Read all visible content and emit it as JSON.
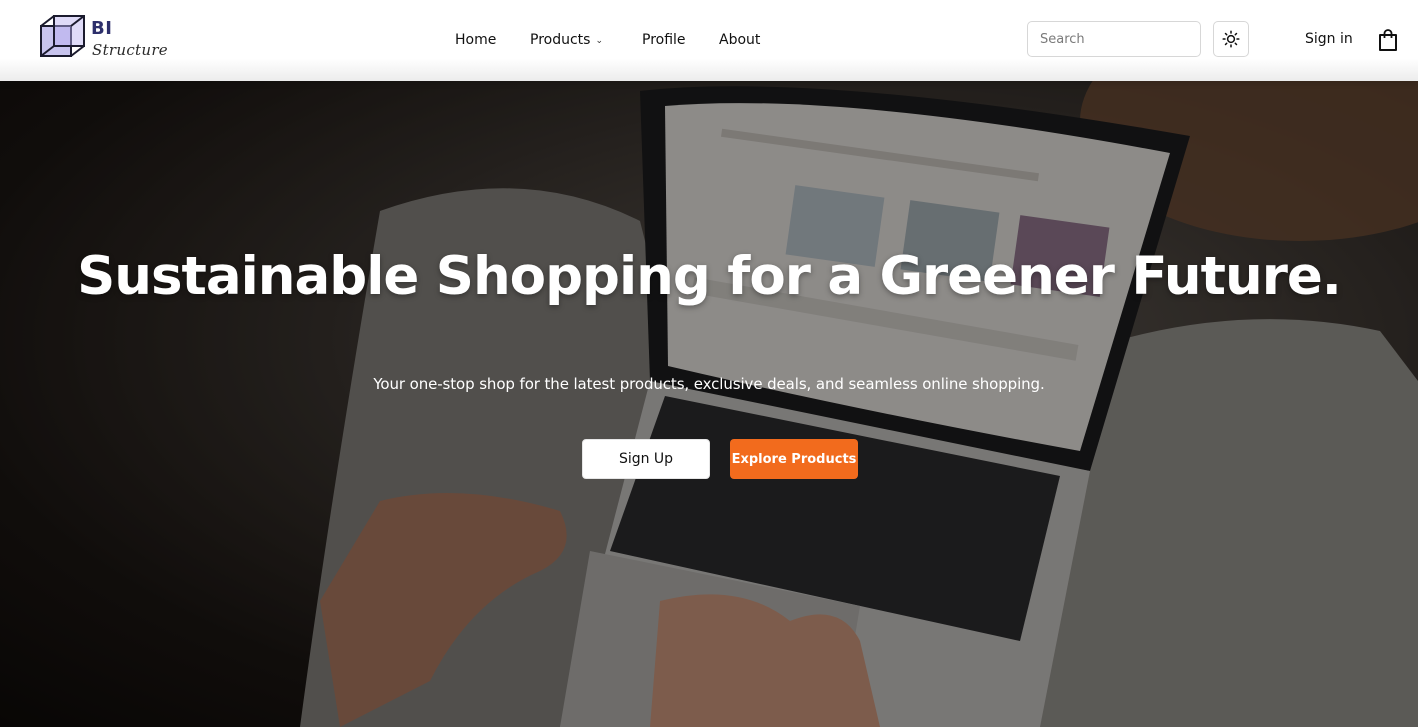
{
  "brand": {
    "line1": "BI",
    "line2": "Structure"
  },
  "nav": [
    {
      "label": "Home",
      "dropdown": false
    },
    {
      "label": "Products",
      "dropdown": true
    },
    {
      "label": "Profile",
      "dropdown": false
    },
    {
      "label": "About",
      "dropdown": false
    }
  ],
  "search": {
    "placeholder": "Search",
    "value": ""
  },
  "header": {
    "theme_icon": "sun-icon",
    "signin_label": "Sign in",
    "cart_icon": "shopping-bag-icon"
  },
  "hero": {
    "title": "Sustainable Shopping for a Greener Future.",
    "subtitle": "Your one-stop shop for the latest products, exclusive deals, and seamless online shopping.",
    "signup_label": "Sign Up",
    "explore_label": "Explore Products"
  },
  "colors": {
    "accent": "#f26b1d",
    "brand": "#2d2f6b",
    "logo_fill": "#8b82d6"
  }
}
